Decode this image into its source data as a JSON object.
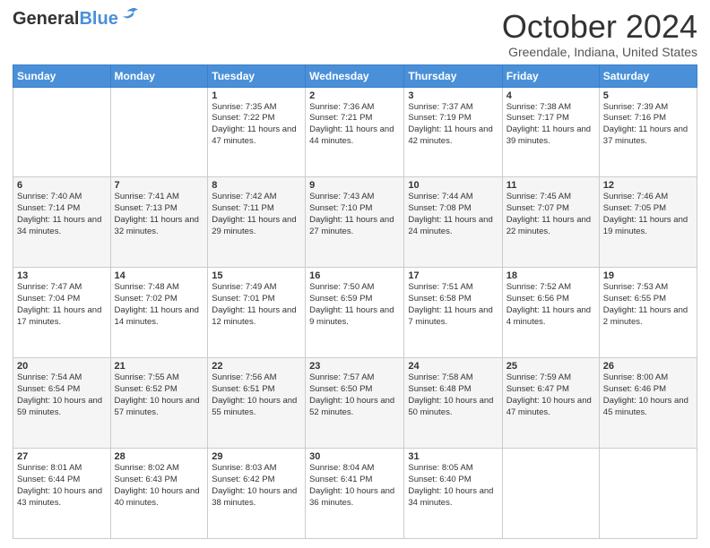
{
  "header": {
    "logo_line1": "General",
    "logo_line2": "Blue",
    "month": "October 2024",
    "location": "Greendale, Indiana, United States"
  },
  "days_of_week": [
    "Sunday",
    "Monday",
    "Tuesday",
    "Wednesday",
    "Thursday",
    "Friday",
    "Saturday"
  ],
  "weeks": [
    [
      {
        "day": "",
        "info": ""
      },
      {
        "day": "",
        "info": ""
      },
      {
        "day": "1",
        "info": "Sunrise: 7:35 AM\nSunset: 7:22 PM\nDaylight: 11 hours and 47 minutes."
      },
      {
        "day": "2",
        "info": "Sunrise: 7:36 AM\nSunset: 7:21 PM\nDaylight: 11 hours and 44 minutes."
      },
      {
        "day": "3",
        "info": "Sunrise: 7:37 AM\nSunset: 7:19 PM\nDaylight: 11 hours and 42 minutes."
      },
      {
        "day": "4",
        "info": "Sunrise: 7:38 AM\nSunset: 7:17 PM\nDaylight: 11 hours and 39 minutes."
      },
      {
        "day": "5",
        "info": "Sunrise: 7:39 AM\nSunset: 7:16 PM\nDaylight: 11 hours and 37 minutes."
      }
    ],
    [
      {
        "day": "6",
        "info": "Sunrise: 7:40 AM\nSunset: 7:14 PM\nDaylight: 11 hours and 34 minutes."
      },
      {
        "day": "7",
        "info": "Sunrise: 7:41 AM\nSunset: 7:13 PM\nDaylight: 11 hours and 32 minutes."
      },
      {
        "day": "8",
        "info": "Sunrise: 7:42 AM\nSunset: 7:11 PM\nDaylight: 11 hours and 29 minutes."
      },
      {
        "day": "9",
        "info": "Sunrise: 7:43 AM\nSunset: 7:10 PM\nDaylight: 11 hours and 27 minutes."
      },
      {
        "day": "10",
        "info": "Sunrise: 7:44 AM\nSunset: 7:08 PM\nDaylight: 11 hours and 24 minutes."
      },
      {
        "day": "11",
        "info": "Sunrise: 7:45 AM\nSunset: 7:07 PM\nDaylight: 11 hours and 22 minutes."
      },
      {
        "day": "12",
        "info": "Sunrise: 7:46 AM\nSunset: 7:05 PM\nDaylight: 11 hours and 19 minutes."
      }
    ],
    [
      {
        "day": "13",
        "info": "Sunrise: 7:47 AM\nSunset: 7:04 PM\nDaylight: 11 hours and 17 minutes."
      },
      {
        "day": "14",
        "info": "Sunrise: 7:48 AM\nSunset: 7:02 PM\nDaylight: 11 hours and 14 minutes."
      },
      {
        "day": "15",
        "info": "Sunrise: 7:49 AM\nSunset: 7:01 PM\nDaylight: 11 hours and 12 minutes."
      },
      {
        "day": "16",
        "info": "Sunrise: 7:50 AM\nSunset: 6:59 PM\nDaylight: 11 hours and 9 minutes."
      },
      {
        "day": "17",
        "info": "Sunrise: 7:51 AM\nSunset: 6:58 PM\nDaylight: 11 hours and 7 minutes."
      },
      {
        "day": "18",
        "info": "Sunrise: 7:52 AM\nSunset: 6:56 PM\nDaylight: 11 hours and 4 minutes."
      },
      {
        "day": "19",
        "info": "Sunrise: 7:53 AM\nSunset: 6:55 PM\nDaylight: 11 hours and 2 minutes."
      }
    ],
    [
      {
        "day": "20",
        "info": "Sunrise: 7:54 AM\nSunset: 6:54 PM\nDaylight: 10 hours and 59 minutes."
      },
      {
        "day": "21",
        "info": "Sunrise: 7:55 AM\nSunset: 6:52 PM\nDaylight: 10 hours and 57 minutes."
      },
      {
        "day": "22",
        "info": "Sunrise: 7:56 AM\nSunset: 6:51 PM\nDaylight: 10 hours and 55 minutes."
      },
      {
        "day": "23",
        "info": "Sunrise: 7:57 AM\nSunset: 6:50 PM\nDaylight: 10 hours and 52 minutes."
      },
      {
        "day": "24",
        "info": "Sunrise: 7:58 AM\nSunset: 6:48 PM\nDaylight: 10 hours and 50 minutes."
      },
      {
        "day": "25",
        "info": "Sunrise: 7:59 AM\nSunset: 6:47 PM\nDaylight: 10 hours and 47 minutes."
      },
      {
        "day": "26",
        "info": "Sunrise: 8:00 AM\nSunset: 6:46 PM\nDaylight: 10 hours and 45 minutes."
      }
    ],
    [
      {
        "day": "27",
        "info": "Sunrise: 8:01 AM\nSunset: 6:44 PM\nDaylight: 10 hours and 43 minutes."
      },
      {
        "day": "28",
        "info": "Sunrise: 8:02 AM\nSunset: 6:43 PM\nDaylight: 10 hours and 40 minutes."
      },
      {
        "day": "29",
        "info": "Sunrise: 8:03 AM\nSunset: 6:42 PM\nDaylight: 10 hours and 38 minutes."
      },
      {
        "day": "30",
        "info": "Sunrise: 8:04 AM\nSunset: 6:41 PM\nDaylight: 10 hours and 36 minutes."
      },
      {
        "day": "31",
        "info": "Sunrise: 8:05 AM\nSunset: 6:40 PM\nDaylight: 10 hours and 34 minutes."
      },
      {
        "day": "",
        "info": ""
      },
      {
        "day": "",
        "info": ""
      }
    ]
  ]
}
